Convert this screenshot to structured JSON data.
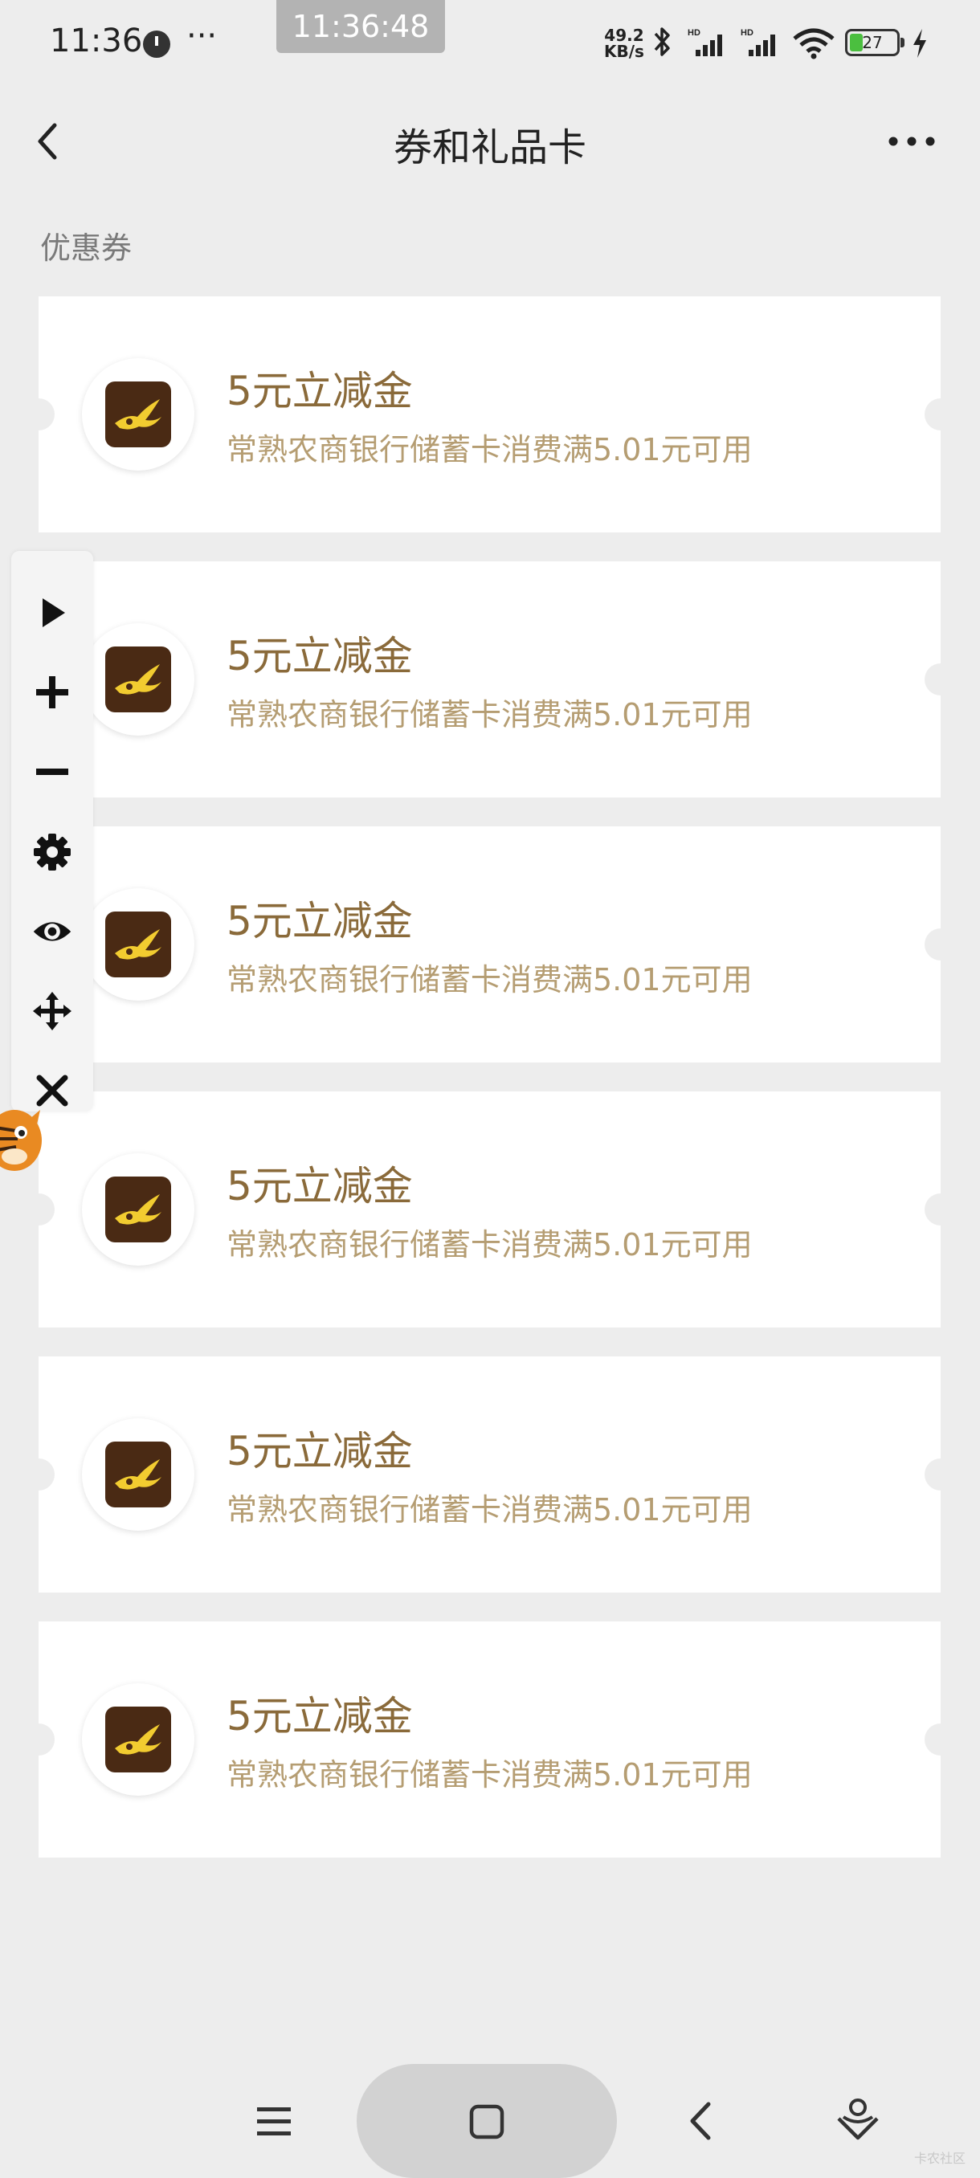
{
  "status_bar": {
    "time": "11:36",
    "dots": "···",
    "overlay_time": "11:36:48",
    "net_speed_value": "49.2",
    "net_speed_unit": "KB/s",
    "battery_level": "27"
  },
  "header": {
    "title": "券和礼品卡"
  },
  "section": {
    "label": "优惠券"
  },
  "coupons": [
    {
      "title": "5元立减金",
      "desc": "常熟农商银行储蓄卡消费满5.01元可用"
    },
    {
      "title": "5元立减金",
      "desc": "常熟农商银行储蓄卡消费满5.01元可用"
    },
    {
      "title": "5元立减金",
      "desc": "常熟农商银行储蓄卡消费满5.01元可用"
    },
    {
      "title": "5元立减金",
      "desc": "常熟农商银行储蓄卡消费满5.01元可用"
    },
    {
      "title": "5元立减金",
      "desc": "常熟农商银行储蓄卡消费满5.01元可用"
    },
    {
      "title": "5元立减金",
      "desc": "常熟农商银行储蓄卡消费满5.01元可用"
    }
  ],
  "toolbar": {
    "icons": [
      "play-icon",
      "plus-icon",
      "minus-icon",
      "gear-icon",
      "eye-icon",
      "move-icon",
      "close-icon"
    ]
  },
  "nav_bar": {
    "icons": [
      "menu-icon",
      "home-square-icon",
      "back-chevron-icon",
      "assistant-icon"
    ]
  },
  "watermark": "卡农社区",
  "colors": {
    "background": "#ededed",
    "card": "#ffffff",
    "coupon_title": "#8a6a3a",
    "coupon_desc": "#b59d72",
    "logo_bg": "#4a2a14",
    "logo_accent": "#f2cc30"
  }
}
